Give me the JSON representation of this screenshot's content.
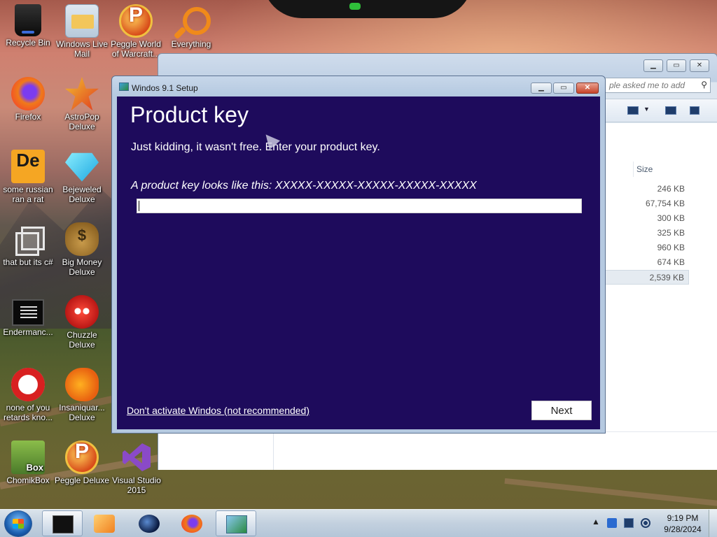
{
  "desktop": {
    "icons": [
      {
        "label": "Recycle Bin"
      },
      {
        "label": "Windows Live Mail"
      },
      {
        "label": "Peggle World of Warcraft..."
      },
      {
        "label": "Everything"
      },
      {
        "label": "Firefox"
      },
      {
        "label": "AstroPop Deluxe"
      },
      {
        "label": "some russian ran a rat"
      },
      {
        "label": "Bejeweled Deluxe"
      },
      {
        "label": "that but its c#"
      },
      {
        "label": "Big Money Deluxe"
      },
      {
        "label": "Endermanc..."
      },
      {
        "label": "Chuzzle Deluxe"
      },
      {
        "label": "none of you retards kno..."
      },
      {
        "label": "Insaniquar... Deluxe"
      },
      {
        "label": "ChomikBox"
      },
      {
        "label": "Peggle Deluxe"
      },
      {
        "label": "Visual Studio 2015"
      }
    ]
  },
  "explorer": {
    "search_placeholder": "ple asked me to add",
    "size_header": "Size",
    "sizes": [
      "246 KB",
      "67,754 KB",
      "300 KB",
      "325 KB",
      "960 KB",
      "674 KB",
      "2,539 KB"
    ]
  },
  "setup": {
    "window_title": "Windos 9.1 Setup",
    "heading": "Product key",
    "subtitle": "Just kidding, it wasn't free. Enter your product key.",
    "hint": "A product key looks like this: XXXXX-XXXXX-XXXXX-XXXXX-XXXXX",
    "key_value": "",
    "skip_link": "Don't activate Windos (not recommended)",
    "next_label": "Next",
    "colors": {
      "body_bg": "#1e0b5c",
      "text": "#ffffff"
    }
  },
  "taskbar": {
    "time": "9:19 PM",
    "date": "9/28/2024"
  }
}
